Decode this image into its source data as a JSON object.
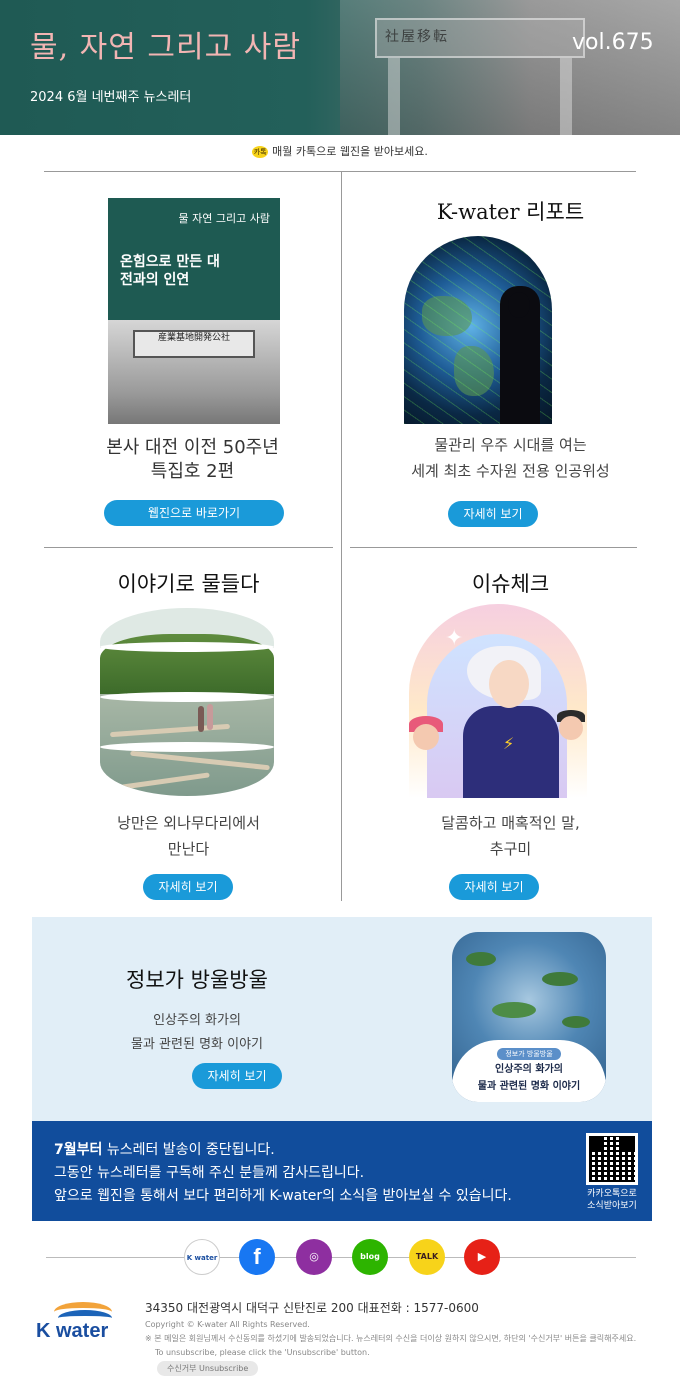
{
  "header": {
    "title": "물, 자연 그리고 사람",
    "subtitle": "2024 6월 네번째주 뉴스레터",
    "volume": "vol.675",
    "photo_sign": "社屋移転",
    "photo_sign2": "産業基地開発公社"
  },
  "kakao_banner": {
    "icon_label": "카톡",
    "text": "매월 카톡으로 웹진을 받아보세요."
  },
  "cards": [
    {
      "title": "",
      "cover": {
        "magazine_title": "물 자연 그리고 사람",
        "headline": "온힘으로 만든 대전과의 인연"
      },
      "desc_lines": [
        "본사 대전 이전 50주년",
        "특집호 2편"
      ],
      "button": "웹진으로 바로가기"
    },
    {
      "title": "K-water 리포트",
      "desc_lines": [
        "물관리 우주 시대를 여는",
        "세계 최초 수자원 전용 인공위성"
      ],
      "button": "자세히 보기"
    },
    {
      "title": "이야기로 물들다",
      "desc_lines": [
        "낭만은 외나무다리에서",
        "만난다"
      ],
      "button": "자세히 보기"
    },
    {
      "title": "이슈체크",
      "desc_lines": [
        "달콤하고 매혹적인 말,",
        "추구미"
      ],
      "button": "자세히 보기"
    }
  ],
  "info": {
    "title": "정보가 방울방울",
    "desc_lines": [
      "인상주의 화가의",
      "물과 관련된 명화 이야기"
    ],
    "button": "자세히 보기",
    "painting_tag": "정보가 방울방울",
    "painting_lines": [
      "인상주의 화가의",
      "물과 관련된 명화 이야기"
    ]
  },
  "notice": {
    "lead": "7월부터",
    "line1_rest": " 뉴스레터 발송이 중단됩니다.",
    "line2": "그동안 뉴스레터를 구독해 주신 분들께 감사드립니다.",
    "line3": "앞으로 웹진을 통해서 보다 편리하게 K-water의 소식을 받아보실 수 있습니다.",
    "qr_label_lines": [
      "카카오톡으로",
      "소식받아보기"
    ]
  },
  "social": [
    {
      "name": "kwater-icon",
      "label": "K water",
      "bg": "#ffffff",
      "fg": "#1a4ea0"
    },
    {
      "name": "facebook-icon",
      "label": "f",
      "bg": "#1877f2",
      "fg": "#ffffff"
    },
    {
      "name": "instagram-icon",
      "label": "◎",
      "bg": "#8e2fa0",
      "fg": "#ffffff"
    },
    {
      "name": "blog-icon",
      "label": "blog",
      "bg": "#2db400",
      "fg": "#ffffff"
    },
    {
      "name": "kakaotalk-icon",
      "label": "TALK",
      "bg": "#f7d31a",
      "fg": "#3b1e1e"
    },
    {
      "name": "youtube-icon",
      "label": "▶",
      "bg": "#e62117",
      "fg": "#ffffff"
    }
  ],
  "footer": {
    "logo_text": "K water",
    "address": "34350 대전광역시 대덕구 신탄진로 200  대표전화 : 1577-0600",
    "copyright": "Copyright © K-water All Rights Reserved.",
    "notice1": "※ 본 메일은 회원님께서 수신동의를 하셨기에 발송되었습니다. 뉴스레터의 수신을 더이상 원하지 않으시면, 하단의 '수신거부' 버튼을 클릭해주세요.",
    "notice2": "To unsubscribe, please click the 'Unsubscribe' button.",
    "unsubscribe": "수신거부  Unsubscribe"
  },
  "colors": {
    "header_bg": "#1f5a54",
    "accent_pink": "#f2b5b3",
    "button_blue": "#1a9ad9",
    "notice_blue": "#114d9c",
    "info_bg": "#e1eef7"
  }
}
